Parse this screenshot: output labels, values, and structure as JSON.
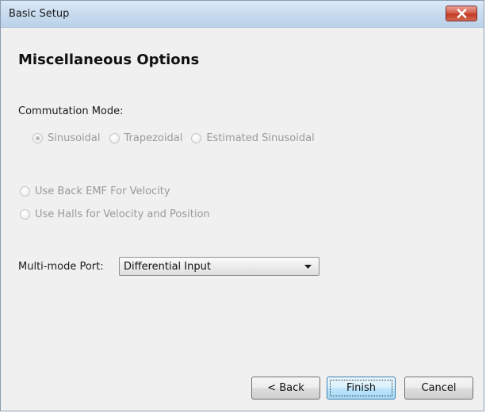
{
  "window": {
    "title": "Basic Setup"
  },
  "page": {
    "heading": "Miscellaneous Options"
  },
  "commutation": {
    "label": "Commutation Mode:",
    "options": [
      {
        "label": "Sinusoidal",
        "checked": true,
        "enabled": false
      },
      {
        "label": "Trapezoidal",
        "checked": false,
        "enabled": false
      },
      {
        "label": "Estimated Sinusoidal",
        "checked": false,
        "enabled": false
      }
    ]
  },
  "velocity": {
    "options": [
      {
        "label": "Use Back EMF For Velocity",
        "checked": false,
        "enabled": false
      },
      {
        "label": "Use Halls for Velocity and Position",
        "checked": false,
        "enabled": false
      }
    ]
  },
  "multimode": {
    "label": "Multi-mode Port:",
    "value": "Differential Input"
  },
  "buttons": {
    "back": "< Back",
    "finish": "Finish",
    "cancel": "Cancel"
  },
  "colors": {
    "titlebar": "#c8dbef",
    "close_button": "#c23b22",
    "disabled_text": "#9a9a9a",
    "default_button_border": "#3c7fb1"
  },
  "icons": {
    "close": "close-icon",
    "dropdown": "chevron-down-icon"
  }
}
